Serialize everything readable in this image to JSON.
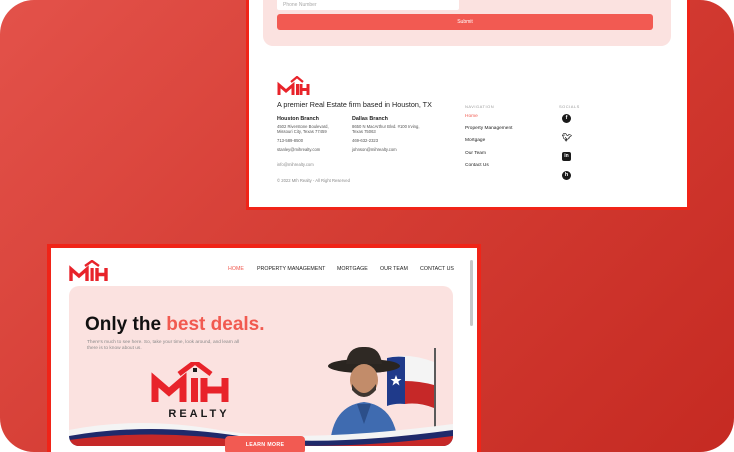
{
  "contact_form": {
    "phone_placeholder": "Phone Number",
    "submit_label": "Submit"
  },
  "footer": {
    "logo_text": "MIH",
    "tagline": "A premier Real Estate firm based in Houston, TX",
    "branches": [
      {
        "name": "Houston Branch",
        "address_line1": "4502 Riverstone Boulevard,",
        "address_line2": "Missouri City, Texas 77459",
        "phone": "713-589-8500",
        "email": "stanley@mihrealty.com"
      },
      {
        "name": "Dallas Branch",
        "address_line1": "8650 N MacArthur Blvd. #100 Irving,",
        "address_line2": "Texas 75063",
        "phone": "469-632-2323",
        "email": "johnson@mihrealty.com"
      }
    ],
    "general_email": "info@mihrealty.com",
    "copyright": "© 2022 MIh Realty - All Right Reserved",
    "nav_heading": "NAVIGATION",
    "nav_links": [
      "Home",
      "Property Management",
      "Mortgage",
      "Our Team",
      "Contact Us"
    ],
    "social_heading": "SOCIALS",
    "socials": [
      {
        "icon": "facebook-icon",
        "glyph": "f"
      },
      {
        "icon": "twitter-icon",
        "glyph": "t"
      },
      {
        "icon": "linkedin-icon",
        "glyph": "in"
      },
      {
        "icon": "houzz-icon",
        "glyph": "h"
      }
    ]
  },
  "header": {
    "logo_text": "MIH",
    "nav": [
      "HOME",
      "PROPERTY MANAGEMENT",
      "MORTGAGE",
      "OUR TEAM",
      "CONTACT US"
    ]
  },
  "hero": {
    "title_part1": "Only the ",
    "title_accent": "best deals.",
    "subtitle": "There's much to see here. So, take your time, look around, and learn all there is to know about us.",
    "logo_text": "MIH",
    "logo_subtext": "REALTY",
    "cta_label": "LEARN MORE"
  },
  "colors": {
    "accent": "#f15a50",
    "brand_red": "#e8232a",
    "frame": "#f02418",
    "hero_bg": "#fbe2e0",
    "wave_navy": "#1f2a6b"
  }
}
